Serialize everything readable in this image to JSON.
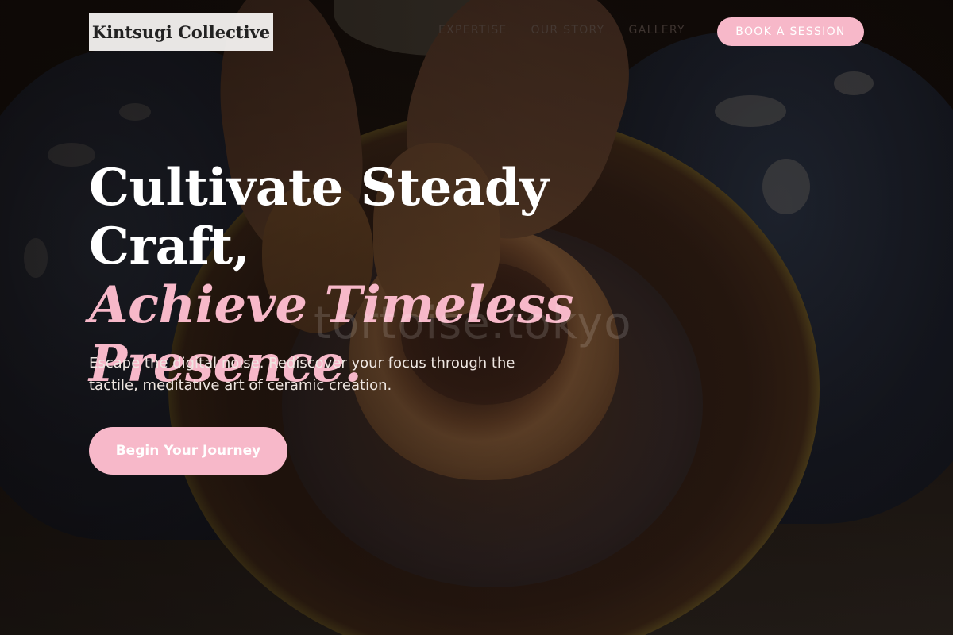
{
  "brand": {
    "name": "Kintsugi Collective",
    "accent_color": "#f7b8c9"
  },
  "nav": {
    "links": [
      "EXPERTISE",
      "OUR STORY",
      "GALLERY"
    ],
    "cta_label": "BOOK A SESSION"
  },
  "hero": {
    "title_line1": "Cultivate Steady Craft,",
    "title_line2": "Achieve Timeless",
    "title_line3": "Presence.",
    "subtitle": "Escape the digital noise. Rediscover your focus through the tactile, meditative art of ceramic creation.",
    "cta_label": "Begin Your Journey",
    "background_image": "pottery-wheel-hands-photo"
  },
  "watermark": "tortoise.tokyo"
}
